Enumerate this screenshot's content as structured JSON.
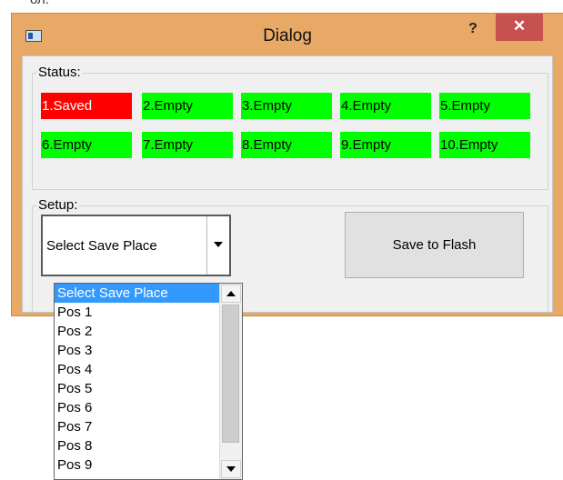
{
  "top_fragment": "ол.",
  "window": {
    "title": "Dialog",
    "help_label": "?",
    "close_label": "✕",
    "icon": "app-window-icon"
  },
  "status": {
    "label": "Status:",
    "slots": [
      {
        "label": "1.Saved",
        "state": "saved"
      },
      {
        "label": "2.Empty",
        "state": "empty"
      },
      {
        "label": "3.Empty",
        "state": "empty"
      },
      {
        "label": "4.Empty",
        "state": "empty"
      },
      {
        "label": "5.Empty",
        "state": "empty"
      },
      {
        "label": "6.Empty",
        "state": "empty"
      },
      {
        "label": "7.Empty",
        "state": "empty"
      },
      {
        "label": "8.Empty",
        "state": "empty"
      },
      {
        "label": "9.Empty",
        "state": "empty"
      },
      {
        "label": "10.Empty",
        "state": "empty"
      }
    ],
    "colors": {
      "saved": "#ff0000",
      "empty": "#00ff00"
    }
  },
  "setup": {
    "label": "Setup:",
    "combo_value": "Select Save Place",
    "save_button": "Save to Flash",
    "dropdown_items": [
      "Select Save Place",
      "Pos 1",
      "Pos 2",
      "Pos 3",
      "Pos 4",
      "Pos 5",
      "Pos 6",
      "Pos 7",
      "Pos 8",
      "Pos 9"
    ],
    "selected_index": 0
  }
}
